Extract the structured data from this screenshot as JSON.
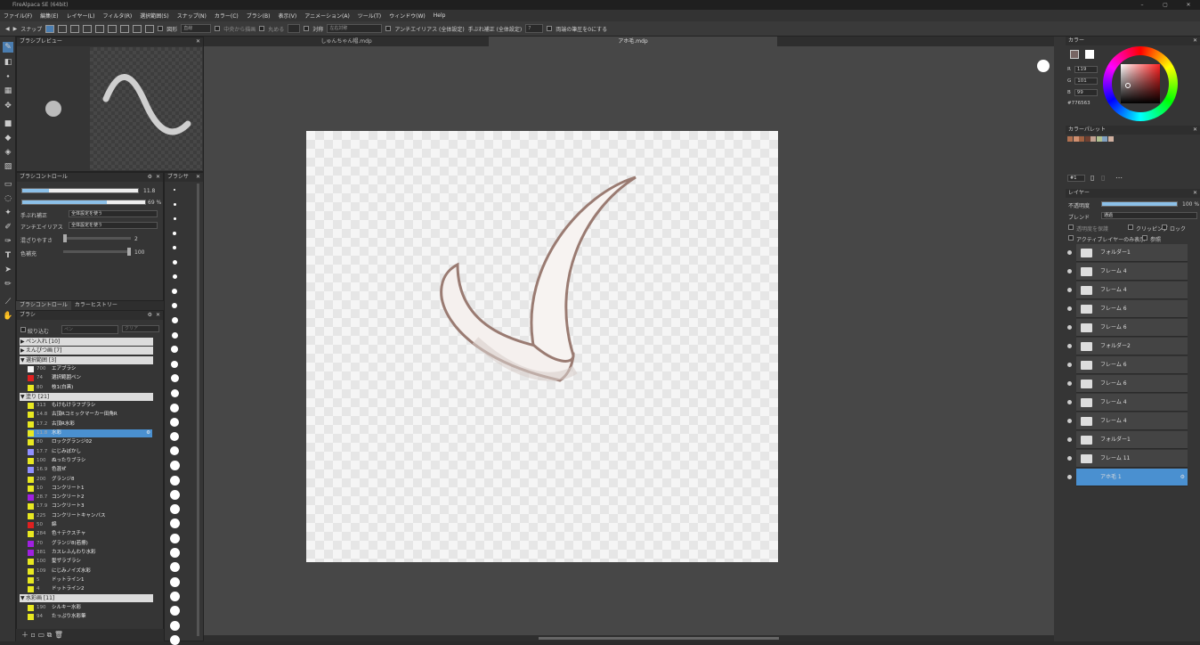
{
  "titlebar": {
    "title": "FireAlpaca SE (64bit)"
  },
  "menu": [
    "ファイル(F)",
    "編集(E)",
    "レイヤー(L)",
    "フィルタ(R)",
    "選択範囲(S)",
    "スナップ(N)",
    "カラー(C)",
    "ブラシ(B)",
    "表示(V)",
    "アニメーション(A)",
    "ツール(T)",
    "ウィンドウ(W)",
    "Help"
  ],
  "toolbar": {
    "snap_label": "スナップ",
    "shape_label": "図形",
    "shape_value": "直線",
    "select_opt": "中央から描画",
    "round_label": "丸める",
    "sym_label": "対称",
    "sym_value": "左右対称",
    "aa_label": "アンチエイリアス (全体設定)",
    "stab_label": "手ぶれ補正 (全体設定)",
    "stab_value": "7",
    "pressure_label": "両端の筆圧を0にする"
  },
  "brush_preview": {
    "title": "ブラシプレビュー"
  },
  "brush_control": {
    "title": "ブラシコントロール",
    "size_value": "11.8",
    "opacity_value": "69 %",
    "stab_label": "手ぶれ補正",
    "stab_value": "全体設定を使う",
    "aa_label": "アンチエイリアス",
    "aa_value": "全体設定を使う",
    "blend_label": "混ざりやすさ",
    "blend_value": "2",
    "color_label": "色補充",
    "color_value": "100"
  },
  "size_panel": {
    "title": "ブラシサ"
  },
  "tabs": [
    "ブラシコントロール",
    "カラーヒストリー"
  ],
  "brush_list": {
    "title": "ブラシ",
    "filter_label": "絞り込む",
    "filter_placeholder": "ペン",
    "filter_btn": "クリア",
    "groups": [
      {
        "name": "ペン入れ [10]",
        "items": []
      },
      {
        "name": "えんぴつ画 [7]",
        "items": []
      },
      {
        "name": "選択範囲 [3]",
        "items": [
          {
            "size": "700",
            "name": "エアブラシ",
            "color": "#f4f4f4"
          },
          {
            "size": "74",
            "name": "選択範囲ペン",
            "color": "#e02020"
          },
          {
            "size": "80",
            "name": "枝1(白黒)",
            "color": "#e8e820"
          }
        ]
      },
      {
        "name": "塗り [21]",
        "items": [
          {
            "size": "313",
            "name": "もけもけラフブラシ",
            "color": "#e8e820"
          },
          {
            "size": "14.8",
            "name": "古頂Rコミックマーカー田角R",
            "color": "#e8e820"
          },
          {
            "size": "17.2",
            "name": "古頂R水彩",
            "color": "#e8e820"
          },
          {
            "size": "11.8",
            "name": "水彩",
            "color": "#e8e820",
            "selected": true
          },
          {
            "size": "80",
            "name": "ロックグランジ02",
            "color": "#e8e820"
          },
          {
            "size": "17.7",
            "name": "にじみぼかし",
            "color": "#9090ff"
          },
          {
            "size": "100",
            "name": "ぬったりブラシ",
            "color": "#e8e820"
          },
          {
            "size": "16.9",
            "name": "色混ぜ",
            "color": "#9090ff"
          },
          {
            "size": "200",
            "name": "グランジ8",
            "color": "#e8e820"
          },
          {
            "size": "10",
            "name": "コンクリート1",
            "color": "#e8e820"
          },
          {
            "size": "28.7",
            "name": "コンクリート2",
            "color": "#a020e0"
          },
          {
            "size": "17.9",
            "name": "コンクリート3",
            "color": "#e8e820"
          },
          {
            "size": "225",
            "name": "コンクリートキャンバス",
            "color": "#e8e820"
          },
          {
            "size": "50",
            "name": "綿",
            "color": "#e02020"
          },
          {
            "size": "284",
            "name": "色＋テクスチャ",
            "color": "#e8e820"
          },
          {
            "size": "70",
            "name": "グランジ8(若擦)",
            "color": "#a020e0"
          },
          {
            "size": "381",
            "name": "カスレふんわり水彩",
            "color": "#a020e0"
          },
          {
            "size": "100",
            "name": "髪ザラブラシ",
            "color": "#e8e820"
          },
          {
            "size": "109",
            "name": "にじみノイズ水彩",
            "color": "#e8e820"
          },
          {
            "size": "5",
            "name": "ドットライン1",
            "color": "#e8e820"
          },
          {
            "size": "4",
            "name": "ドットライン2",
            "color": "#e8e820"
          }
        ]
      },
      {
        "name": "水彩画 [11]",
        "items": [
          {
            "size": "190",
            "name": "シルキー水彩",
            "color": "#e8e820"
          },
          {
            "size": "94",
            "name": "たっぷり水彩筆",
            "color": "#e8e820"
          }
        ]
      }
    ]
  },
  "doc_tabs": [
    "しゅんちゃん帽.mdp",
    "アホ毛.mdp"
  ],
  "color": {
    "title": "カラー",
    "r": "119",
    "g": "101",
    "b": "99",
    "hex": "#776563"
  },
  "palette": {
    "title": "カラーパレット",
    "colors": [
      "#b07050",
      "#d09070",
      "#a06040",
      "#704030",
      "#c0a090",
      "#b0c090",
      "#80a0c0",
      "#d0b0a0"
    ]
  },
  "layer": {
    "title": "レイヤー",
    "layer_num": "#1",
    "opacity_label": "不透明度",
    "opacity_value": "100 %",
    "blend_label": "ブレンド",
    "blend_value": "通過",
    "protect_label": "透明度を保護",
    "clip_label": "クリッピング",
    "lock_label": "ロック",
    "active_label": "アクティブレイヤーのみ表示",
    "ref_label": "参照",
    "layers": [
      {
        "name": "フォルダー1"
      },
      {
        "name": "フレーム 4"
      },
      {
        "name": "フレーム 4"
      },
      {
        "name": "フレーム 6"
      },
      {
        "name": "フレーム 6"
      },
      {
        "name": "フォルダー2"
      },
      {
        "name": "フレーム 6"
      },
      {
        "name": "フレーム 6"
      },
      {
        "name": "フレーム 4"
      },
      {
        "name": "フレーム 4"
      },
      {
        "name": "フォルダー1"
      },
      {
        "name": "フレーム 11"
      },
      {
        "name": "アホ毛 1",
        "selected": true
      }
    ]
  }
}
